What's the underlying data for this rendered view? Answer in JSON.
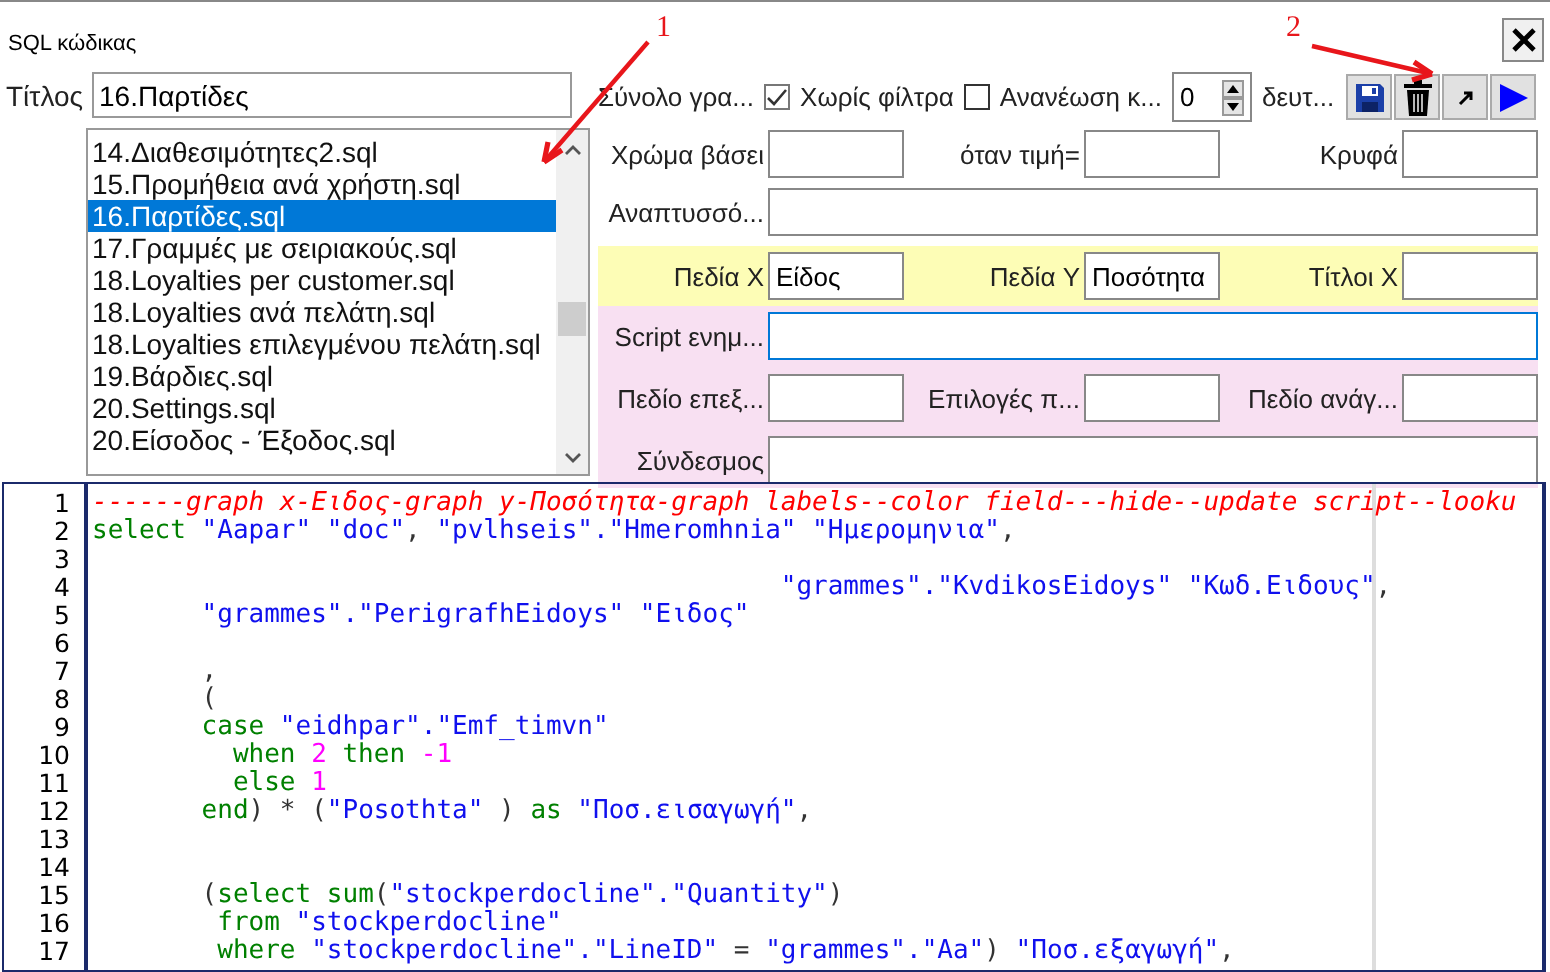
{
  "window": {
    "title": "SQL κώδικας"
  },
  "annotations": [
    {
      "label": "1"
    },
    {
      "label": "2"
    }
  ],
  "title_field": {
    "label": "Τίτλος",
    "value": "16.Παρτίδες"
  },
  "file_list": {
    "items": [
      {
        "label": "14.Διαθεσιμότητες2.sql",
        "selected": false
      },
      {
        "label": "15.Προμήθεια ανά χρήστη.sql",
        "selected": false
      },
      {
        "label": "16.Παρτίδες.sql",
        "selected": true
      },
      {
        "label": "17.Γραμμές με σειριακούς.sql",
        "selected": false
      },
      {
        "label": "18.Loyalties per customer.sql",
        "selected": false
      },
      {
        "label": "18.Loyalties ανά πελάτη.sql",
        "selected": false
      },
      {
        "label": "18.Loyalties επιλεγμένου πελάτη.sql",
        "selected": false
      },
      {
        "label": "19.Βάρδιες.sql",
        "selected": false
      },
      {
        "label": "20.Settings.sql",
        "selected": false
      },
      {
        "label": "20.Είσοδος - Έξοδος.sql",
        "selected": false
      }
    ]
  },
  "options": {
    "checks": [
      {
        "label": "Σύνολο γρα...",
        "checked": true
      },
      {
        "label": "Χωρίς φίλτρα",
        "checked": false
      }
    ],
    "refresh": {
      "label": "Ανανέωση κ...",
      "value": "0",
      "unit": "δευτ..."
    }
  },
  "sections": [
    {
      "kind": "plain",
      "rows": [
        [
          {
            "label": "Χρώμα βάσει",
            "focused": false
          },
          {
            "label": "όταν τιμή=",
            "focused": false
          },
          {
            "label": "Κρυφά",
            "focused": false
          }
        ],
        [
          {
            "label": "Αναπτυσσό...",
            "focused": false
          }
        ]
      ]
    },
    {
      "kind": "yellow",
      "rows": [
        [
          {
            "label": "Πεδία X",
            "value": "Είδος",
            "focused": false
          },
          {
            "label": "Πεδία Y",
            "value": "Ποσότητα",
            "focused": false
          },
          {
            "label": "Τίτλοι X",
            "focused": false
          }
        ]
      ]
    },
    {
      "kind": "pink",
      "rows": [
        [
          {
            "label": "Script ενημ...",
            "focused": true
          }
        ],
        [
          {
            "label": "Πεδίο επεξ...",
            "focused": false
          },
          {
            "label": "Επιλογές π...",
            "focused": false
          },
          {
            "label": "Πεδίο ανάγ...",
            "focused": false
          }
        ],
        [
          {
            "label": "Σύνδεσμος",
            "focused": false
          }
        ]
      ]
    }
  ],
  "editor": {
    "lines": [
      {
        "n": "1",
        "tokens": [
          {
            "kind": "comment",
            "text": "------graph x-Ειδος-graph y-Ποσότητα-graph labels--color field---hide--update script--looku"
          }
        ]
      },
      {
        "n": "2",
        "tokens": [
          {
            "kind": "keyword",
            "text": "select "
          },
          {
            "kind": "string",
            "text": "\"Aapar\" \"doc\""
          },
          {
            "kind": "punct",
            "text": ", "
          },
          {
            "kind": "string",
            "text": "\"pvlhseis\".\"Hmeromhnia\" \"Ημερομηνια\""
          },
          {
            "kind": "punct",
            "text": ","
          }
        ]
      },
      {
        "n": "3"
      },
      {
        "n": "4",
        "tokens": [
          {
            "kind": "string",
            "text": "                                            \"grammes\".\"KvdikosEidoys\" \"Κωδ.Ειδους\""
          },
          {
            "kind": "punct",
            "text": ","
          }
        ]
      },
      {
        "n": "5",
        "tokens": [
          {
            "kind": "string",
            "text": "       \"grammes\".\"PerigrafhEidoys\" \"Ειδος\""
          }
        ]
      },
      {
        "n": "6"
      },
      {
        "n": "7",
        "tokens": [
          {
            "kind": "punct",
            "text": "       ,"
          }
        ]
      },
      {
        "n": "8",
        "tokens": [
          {
            "kind": "punct",
            "text": "       ("
          }
        ]
      },
      {
        "n": "9",
        "tokens": [
          {
            "kind": "keyword",
            "text": "       case "
          },
          {
            "kind": "string",
            "text": "\"eidhpar\".\"Emf_timvn\""
          }
        ]
      },
      {
        "n": "10",
        "tokens": [
          {
            "kind": "keyword",
            "text": "         when "
          },
          {
            "kind": "number",
            "text": "2 "
          },
          {
            "kind": "keyword",
            "text": "then "
          },
          {
            "kind": "number",
            "text": "-1"
          }
        ]
      },
      {
        "n": "11",
        "tokens": [
          {
            "kind": "keyword",
            "text": "         else "
          },
          {
            "kind": "number",
            "text": "1"
          }
        ]
      },
      {
        "n": "12",
        "tokens": [
          {
            "kind": "keyword",
            "text": "       end"
          },
          {
            "kind": "punct",
            "text": ") * ("
          },
          {
            "kind": "string",
            "text": "\"Posothta\""
          },
          {
            "kind": "punct",
            "text": " ) "
          },
          {
            "kind": "keyword",
            "text": "as "
          },
          {
            "kind": "string",
            "text": "\"Ποσ.εισαγωγή\""
          },
          {
            "kind": "punct",
            "text": ","
          }
        ]
      },
      {
        "n": "13"
      },
      {
        "n": "14"
      },
      {
        "n": "15",
        "tokens": [
          {
            "kind": "punct",
            "text": "       ("
          },
          {
            "kind": "keyword",
            "text": "select sum"
          },
          {
            "kind": "punct",
            "text": "("
          },
          {
            "kind": "string",
            "text": "\"stockperdocline\".\"Quantity\""
          },
          {
            "kind": "punct",
            "text": ")"
          }
        ]
      },
      {
        "n": "16",
        "tokens": [
          {
            "kind": "keyword",
            "text": "        from "
          },
          {
            "kind": "string",
            "text": "\"stockperdocline\""
          }
        ]
      },
      {
        "n": "17",
        "tokens": [
          {
            "kind": "keyword",
            "text": "        where "
          },
          {
            "kind": "string",
            "text": "\"stockperdocline\".\"LineID\""
          },
          {
            "kind": "punct",
            "text": " = "
          },
          {
            "kind": "string",
            "text": "\"grammes\".\"Aa\""
          },
          {
            "kind": "punct",
            "text": ") "
          },
          {
            "kind": "string",
            "text": "\"Ποσ.εξαγωγή\""
          },
          {
            "kind": "punct",
            "text": ","
          }
        ]
      }
    ]
  }
}
